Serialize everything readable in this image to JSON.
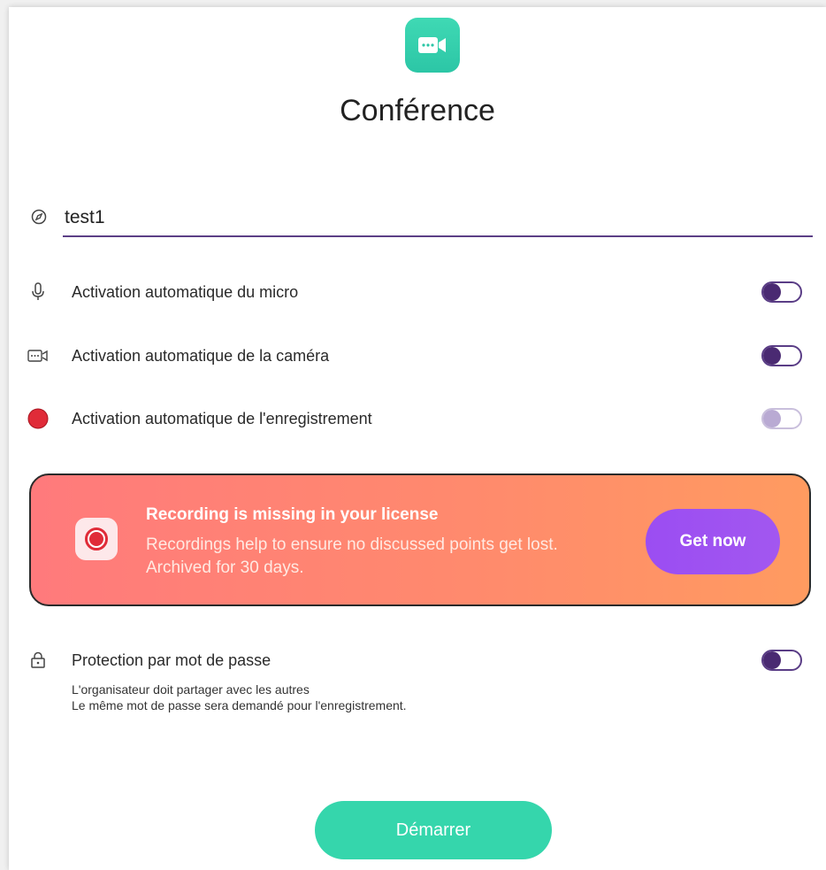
{
  "header": {
    "title": "Conférence",
    "app_icon": "video-conference-icon",
    "accent_color": "#2cc6a6"
  },
  "name_field": {
    "icon": "compass-icon",
    "value": "test1"
  },
  "options": [
    {
      "icon": "microphone-icon",
      "label": "Activation automatique du micro",
      "enabled": false
    },
    {
      "icon": "camera-icon",
      "label": "Activation automatique de la caméra",
      "enabled": false
    },
    {
      "icon": "record-dot-icon",
      "label": "Activation automatique de l'enregistrement",
      "enabled": false,
      "disabled": true
    }
  ],
  "banner": {
    "icon": "record-icon",
    "title": "Recording is missing in your license",
    "line1": "Recordings help to ensure no discussed points get lost.",
    "line2": "Archived for 30 days.",
    "cta_label": "Get now"
  },
  "password": {
    "icon": "lock-icon",
    "label": "Protection par mot de passe",
    "enabled": false,
    "hint_line1": "L'organisateur doit partager avec les autres",
    "hint_line2": "Le même mot de passe sera demandé pour l'enregistrement."
  },
  "start_button": {
    "label": "Démarrer",
    "color": "#35d6ac"
  },
  "toggle_color": "#4a2a72"
}
